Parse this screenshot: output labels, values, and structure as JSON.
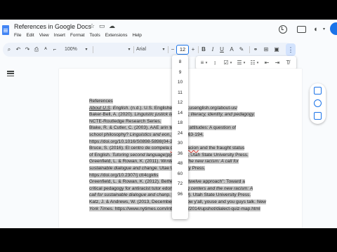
{
  "window": {
    "title": "References in Google Docs",
    "menu": [
      "File",
      "Edit",
      "View",
      "Insert",
      "Format",
      "Tools",
      "Extensions",
      "Help"
    ]
  },
  "toolbar": {
    "zoom": "100%",
    "font": "Arial",
    "font_size": "12",
    "minus": "−",
    "plus": "+",
    "bold": "B",
    "italic": "I",
    "underline": "U",
    "more": "⋮"
  },
  "font_size_options": [
    "8",
    "9",
    "10",
    "11",
    "12",
    "14",
    "18",
    "24",
    "30",
    "36",
    "48",
    "60",
    "72",
    "96"
  ],
  "document": {
    "lines": [
      {
        "segments": [
          {
            "text": "References",
            "style": ""
          }
        ]
      },
      {
        "segments": [
          {
            "text": "About U.S",
            "style": "i u"
          },
          {
            "text": ". ",
            "style": ""
          },
          {
            "text": "English",
            "style": "i"
          },
          {
            "text": ". (n.d.). U.S. Englis",
            "style": ""
          },
          {
            "text": "hes://www.usenglish.org/about-us/",
            "style": ""
          }
        ]
      },
      {
        "segments": [
          {
            "text": "Baker-Bell, A. (2020). ",
            "style": ""
          },
          {
            "text": "Linguistic justic",
            "style": "i"
          },
          {
            "text": "k language, literacy, identity, and pedagogy.",
            "style": "i"
          }
        ]
      },
      {
        "segments": [
          {
            "text": "NCTE-Routledge Research Series.",
            "style": ""
          }
        ]
      },
      {
        "segments": [
          {
            "text": "Blake, R. & Cutler, C. (2003). AAE a",
            "style": ""
          },
          {
            "text": "rin teachers' attitudes: A question of",
            "style": ""
          }
        ]
      },
      {
        "segments": [
          {
            "text": "school philosophy? ",
            "style": ""
          },
          {
            "text": "Linguistics and e",
            "style": "i"
          },
          {
            "text": "on, 14(2), 163-194.",
            "style": ""
          }
        ]
      },
      {
        "segments": [
          {
            "text": "https://doi.org/10.1016/S0898-5898(0",
            "style": ""
          },
          {
            "text": "4-2",
            "style": ""
          }
        ]
      },
      {
        "segments": [
          {
            "text": "Bruce, S. (2016). El centro de compe",
            "style": ""
          },
          {
            "text": "la ",
            "style": ""
          },
          {
            "text": "comunicacion",
            "style": "wavy"
          },
          {
            "text": " and the fraught status",
            "style": ""
          }
        ]
      },
      {
        "segments": [
          {
            "text": "of English. ",
            "style": ""
          },
          {
            "text": "Tutoring second language",
            "style": "i"
          },
          {
            "text": "(pp. 78-97). Utah State University Press.",
            "style": ""
          }
        ]
      },
      {
        "segments": [
          {
            "text": "Greenfield, L. & Rowan, K. (2011). Wr",
            "style": ""
          },
          {
            "text": "nters and the new racism: A call for",
            "style": "i"
          }
        ]
      },
      {
        "segments": [
          {
            "text": "sustainable dialogue and change. ",
            "style": "i"
          },
          {
            "text": "Uta",
            "style": ""
          },
          {
            "text": "e University Press.",
            "style": ""
          }
        ]
      },
      {
        "segments": [
          {
            "text": "https://doi.org/10.2307/j ctt4cgk6s",
            "style": ""
          }
        ]
      },
      {
        "segments": [
          {
            "text": "Greenfield, L. & Rowan, K. (2012). Be",
            "style": ""
          },
          {
            "text": "the \"week twelve approach\": Toward a",
            "style": ""
          }
        ]
      },
      {
        "segments": [
          {
            "text": "critical pedagogy for antiracist tutor ed",
            "style": ""
          },
          {
            "text": "on. ",
            "style": ""
          },
          {
            "text": "Writing centers and the new racism: A",
            "style": "i"
          }
        ]
      },
      {
        "segments": [
          {
            "text": "call for sustainable dialogue and chan",
            "style": "i"
          },
          {
            "text": "p. 124-149). Utah State University Press.",
            "style": ""
          }
        ]
      },
      {
        "segments": [
          {
            "text": "Katz, J. & Andrews, W. (2013, December 21). How y'all, youse and you guys talk. ",
            "style": ""
          },
          {
            "text": "New",
            "style": "i"
          }
        ]
      },
      {
        "segments": [
          {
            "text": "York Times",
            "style": "i"
          },
          {
            "text": ". https://www.nytimes.com/interactive/2014/upshot/dialect-quiz-map.html",
            "style": ""
          }
        ]
      }
    ]
  }
}
